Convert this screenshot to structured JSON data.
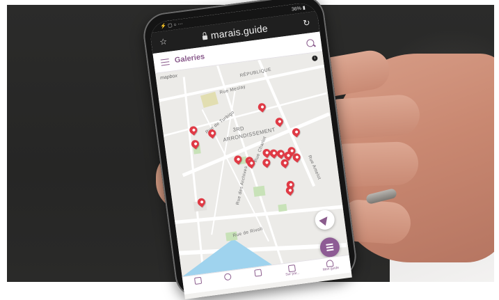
{
  "status_bar": {
    "left": "⚡ ▢ ○ ⋯",
    "right": "36% ▮"
  },
  "browser": {
    "url": "marais.guide"
  },
  "app": {
    "title": "Galeries",
    "info": "i",
    "attribution": "mapbox"
  },
  "map": {
    "labels": [
      {
        "text": "RÉPUBLIQUE",
        "key": "republique"
      },
      {
        "text": "Rue Meslay",
        "key": "meslay"
      },
      {
        "text": "Rue de Turbigo",
        "key": "turbigo"
      },
      {
        "text": "3RD",
        "key": "third"
      },
      {
        "text": "ARRONDISSEMENT",
        "key": "arr"
      },
      {
        "text": "Rue Charlot",
        "key": "charlot"
      },
      {
        "text": "Rue des Archives",
        "key": "archives"
      },
      {
        "text": "Rue de Rivoli",
        "key": "rivoli"
      },
      {
        "text": "Rue Amelot",
        "key": "amelot"
      }
    ],
    "pin_count": 20
  },
  "tabs": [
    {
      "label": ""
    },
    {
      "label": ""
    },
    {
      "label": ""
    },
    {
      "label": "Sur par..."
    },
    {
      "label": "Mon guide"
    }
  ],
  "colors": {
    "accent": "#8a5b8c",
    "pin": "#e03a45",
    "water": "#9fd3ee",
    "park": "#c8e2b8"
  }
}
